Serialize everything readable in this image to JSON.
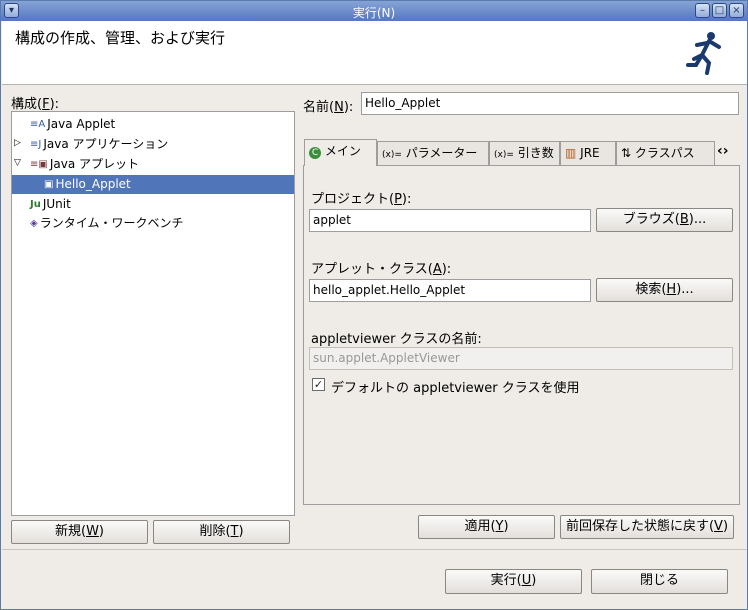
{
  "window": {
    "title": "実行(N)",
    "description": "構成の作成、管理、および実行"
  },
  "left": {
    "config_label_prefix": "構成(",
    "config_label_key": "F",
    "config_label_suffix": "):",
    "tree": [
      {
        "label": "Java Applet",
        "icon": "java-applet-icon"
      },
      {
        "label": "Java アプリケーション",
        "icon": "java-app-icon"
      },
      {
        "label": "Java アプレット",
        "icon": "java-applet-config-icon"
      },
      {
        "label": "Hello_Applet",
        "icon": "applet-config-icon"
      },
      {
        "label": "JUnit",
        "icon": "junit-icon"
      },
      {
        "label": "ランタイム・ワークベンチ",
        "icon": "workbench-icon"
      }
    ],
    "new_btn_prefix": "新規(",
    "new_btn_key": "W",
    "new_btn_suffix": ")",
    "delete_btn_prefix": "削除(",
    "delete_btn_key": "T",
    "delete_btn_suffix": ")"
  },
  "right": {
    "name_label_prefix": "名前(",
    "name_label_key": "N",
    "name_label_suffix": "):",
    "name_value": "Hello_Applet",
    "tabs": [
      {
        "label": "メイン"
      },
      {
        "label": "パラメーター"
      },
      {
        "label": "引き数"
      },
      {
        "label": "JRE"
      },
      {
        "label": "クラスパス"
      }
    ],
    "project_label_prefix": "プロジェクト(",
    "project_label_key": "P",
    "project_label_suffix": "):",
    "project_value": "applet",
    "browse_prefix": "ブラウズ(",
    "browse_key": "B",
    "browse_suffix": ")...",
    "applet_class_label_prefix": "アプレット・クラス(",
    "applet_class_label_key": "A",
    "applet_class_label_suffix": "):",
    "applet_class_value": "hello_applet.Hello_Applet",
    "search_prefix": "検索(",
    "search_key": "H",
    "search_suffix": ")...",
    "viewer_class_label": "appletviewer クラスの名前:",
    "viewer_class_value": "sun.applet.AppletViewer",
    "default_viewer_label": "デフォルトの appletviewer クラスを使用",
    "apply_prefix": "適用(",
    "apply_key": "Y",
    "apply_suffix": ")",
    "revert_prefix": "前回保存した状態に戻す(",
    "revert_key": "V",
    "revert_suffix": ")"
  },
  "footer": {
    "run_prefix": "実行(",
    "run_key": "U",
    "run_suffix": ")",
    "close_label": "閉じる"
  }
}
